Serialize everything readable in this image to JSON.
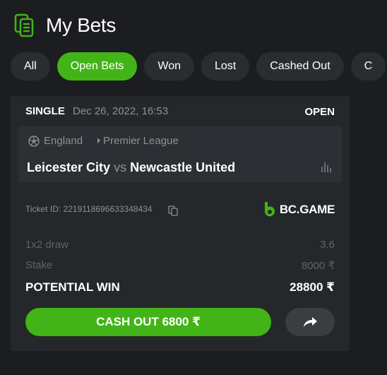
{
  "header": {
    "title": "My Bets"
  },
  "tabs": [
    {
      "label": "All",
      "active": false
    },
    {
      "label": "Open Bets",
      "active": true
    },
    {
      "label": "Won",
      "active": false
    },
    {
      "label": "Lost",
      "active": false
    },
    {
      "label": "Cashed Out",
      "active": false
    },
    {
      "label": "C",
      "active": false
    }
  ],
  "bet": {
    "type": "SINGLE",
    "date": "Dec 26, 2022, 16:53",
    "status": "OPEN",
    "country": "England",
    "league": "Premier League",
    "home": "Leicester City",
    "vs": "vs",
    "away": "Newcastle United",
    "ticket_id": "Ticket ID: 2219118696633348434",
    "brand": "BC.GAME",
    "market_label": "1x2 draw",
    "market_value": "3.6",
    "stake_label": "Stake",
    "stake_value": "8000 ₹",
    "potential_label": "POTENTIAL WIN",
    "potential_value": "28800 ₹",
    "cashout_label": "CASH OUT 6800 ₹"
  },
  "colors": {
    "accent": "#42b417",
    "background": "#1b1d20",
    "card": "#25282b",
    "muted": "#8d9093"
  },
  "icons": [
    "bets-document-icon",
    "soccer-ball-icon",
    "chevron-right-icon",
    "stats-icon",
    "copy-icon",
    "bc-game-logo",
    "share-arrow-icon"
  ]
}
